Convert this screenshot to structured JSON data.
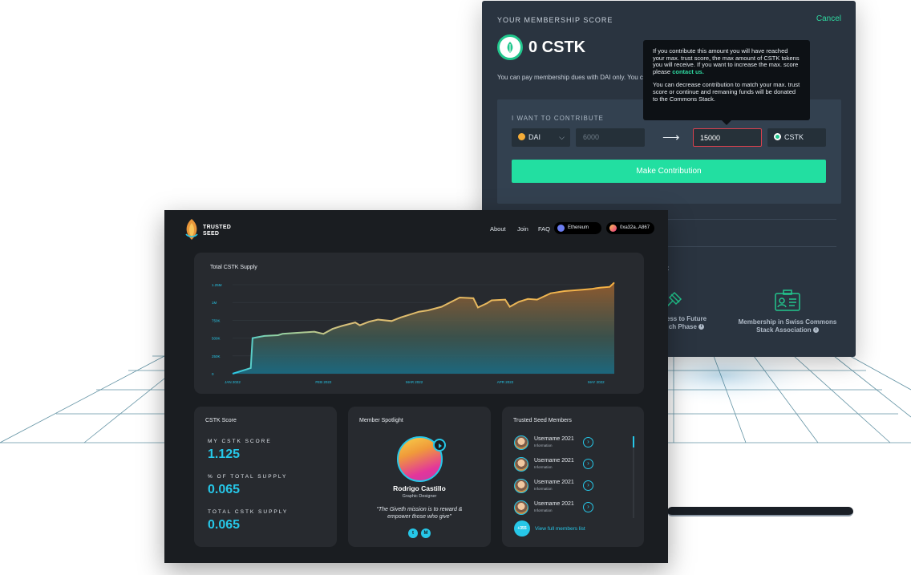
{
  "modal": {
    "title": "YOUR MEMBERSHIP SCORE",
    "cancel_label": "Cancel",
    "score": "0 CSTK",
    "note": "You can pay membership dues with DAI only. You c",
    "box_label": "I WANT TO CONTRIBUTE",
    "pay_currency": "DAI",
    "pay_amount_placeholder": "6000",
    "receive_amount": "15000",
    "receive_currency": "CSTK",
    "contribute_button": "Make Contribution",
    "perks_header": "E:",
    "perks": [
      {
        "line1": "ess to Future",
        "line2": "ch Phase"
      },
      {
        "line1": "Membership in Swiss Commons",
        "line2": "Stack Association"
      }
    ],
    "tooltip": {
      "para1": "If you contribute this amount you will have reached your max. trust score, the max amount of CSTK tokens you will receive. If you want to increase the max. score please",
      "link": "contact us.",
      "para2": "You can decrease contribution to match your max. trust score or continue and remaning funds will be donated to the Commons Stack."
    },
    "colors": {
      "accent": "#22dfa1",
      "error": "#d9414e"
    }
  },
  "dashboard": {
    "brand": {
      "line1": "TRUSTED",
      "line2": "SEED"
    },
    "nav": [
      "About",
      "Join",
      "FAQ"
    ],
    "network": "Ethereum",
    "wallet": "0xa32a..A867",
    "chart_title": "Total CSTK Supply",
    "score_card": {
      "title": "CSTK Score",
      "stats": [
        {
          "label": "MY CSTK SCORE",
          "value": "1.125"
        },
        {
          "label": "% OF TOTAL SUPPLY",
          "value": "0.065"
        },
        {
          "label": "TOTAL CSTK SUPPLY",
          "value": "0.065"
        }
      ]
    },
    "spotlight": {
      "title": "Member Spotlight",
      "name": "Rodrigo Castillo",
      "role": "Graphic Designer",
      "quote": "“The Giveth mission is to reward & empower those who give”"
    },
    "members": {
      "title": "Trusted Seed Members",
      "list": [
        {
          "name": "Username 2021",
          "info": "Information"
        },
        {
          "name": "Username 2021",
          "info": "Information"
        },
        {
          "name": "Username 2021",
          "info": "Information"
        },
        {
          "name": "Username 2021",
          "info": "Information"
        }
      ],
      "more_count": "+355",
      "view_all": "View full members list"
    },
    "colors": {
      "accent": "#26c7e8",
      "line": "#f5b042"
    }
  },
  "chart_data": {
    "type": "area",
    "title": "Total CSTK Supply",
    "xlabel": "",
    "ylabel": "",
    "categories": [
      "JAN 2022",
      "FEB 2022",
      "MAR 2022",
      "APR 2022",
      "MAY 2022"
    ],
    "y_ticks": [
      "0",
      "250K",
      "500K",
      "750K",
      "1M",
      "1.25M"
    ],
    "ylim": [
      0,
      1250000
    ],
    "x_range": [
      0,
      4.2
    ],
    "grid": true,
    "series": [
      {
        "x": [
          0,
          0.2,
          0.22,
          0.35,
          0.5,
          0.55,
          0.9,
          1.0,
          1.1,
          1.2,
          1.35,
          1.4,
          1.5,
          1.6,
          1.75,
          1.85,
          1.95,
          2.05,
          2.15,
          2.3,
          2.5,
          2.65,
          2.7,
          2.8,
          2.85,
          3.0,
          3.05,
          3.15,
          3.25,
          3.35,
          3.4,
          3.5,
          3.55,
          3.65,
          3.75,
          3.85,
          3.95,
          4.0,
          4.05,
          4.15,
          4.2
        ],
        "values": [
          0,
          80000,
          500000,
          530000,
          540000,
          560000,
          590000,
          560000,
          630000,
          670000,
          720000,
          680000,
          730000,
          760000,
          740000,
          790000,
          830000,
          870000,
          890000,
          940000,
          1070000,
          1060000,
          930000,
          990000,
          1030000,
          1040000,
          940000,
          1010000,
          1050000,
          1040000,
          1070000,
          1130000,
          1140000,
          1160000,
          1170000,
          1180000,
          1190000,
          1200000,
          1210000,
          1220000,
          1280000
        ]
      }
    ]
  }
}
